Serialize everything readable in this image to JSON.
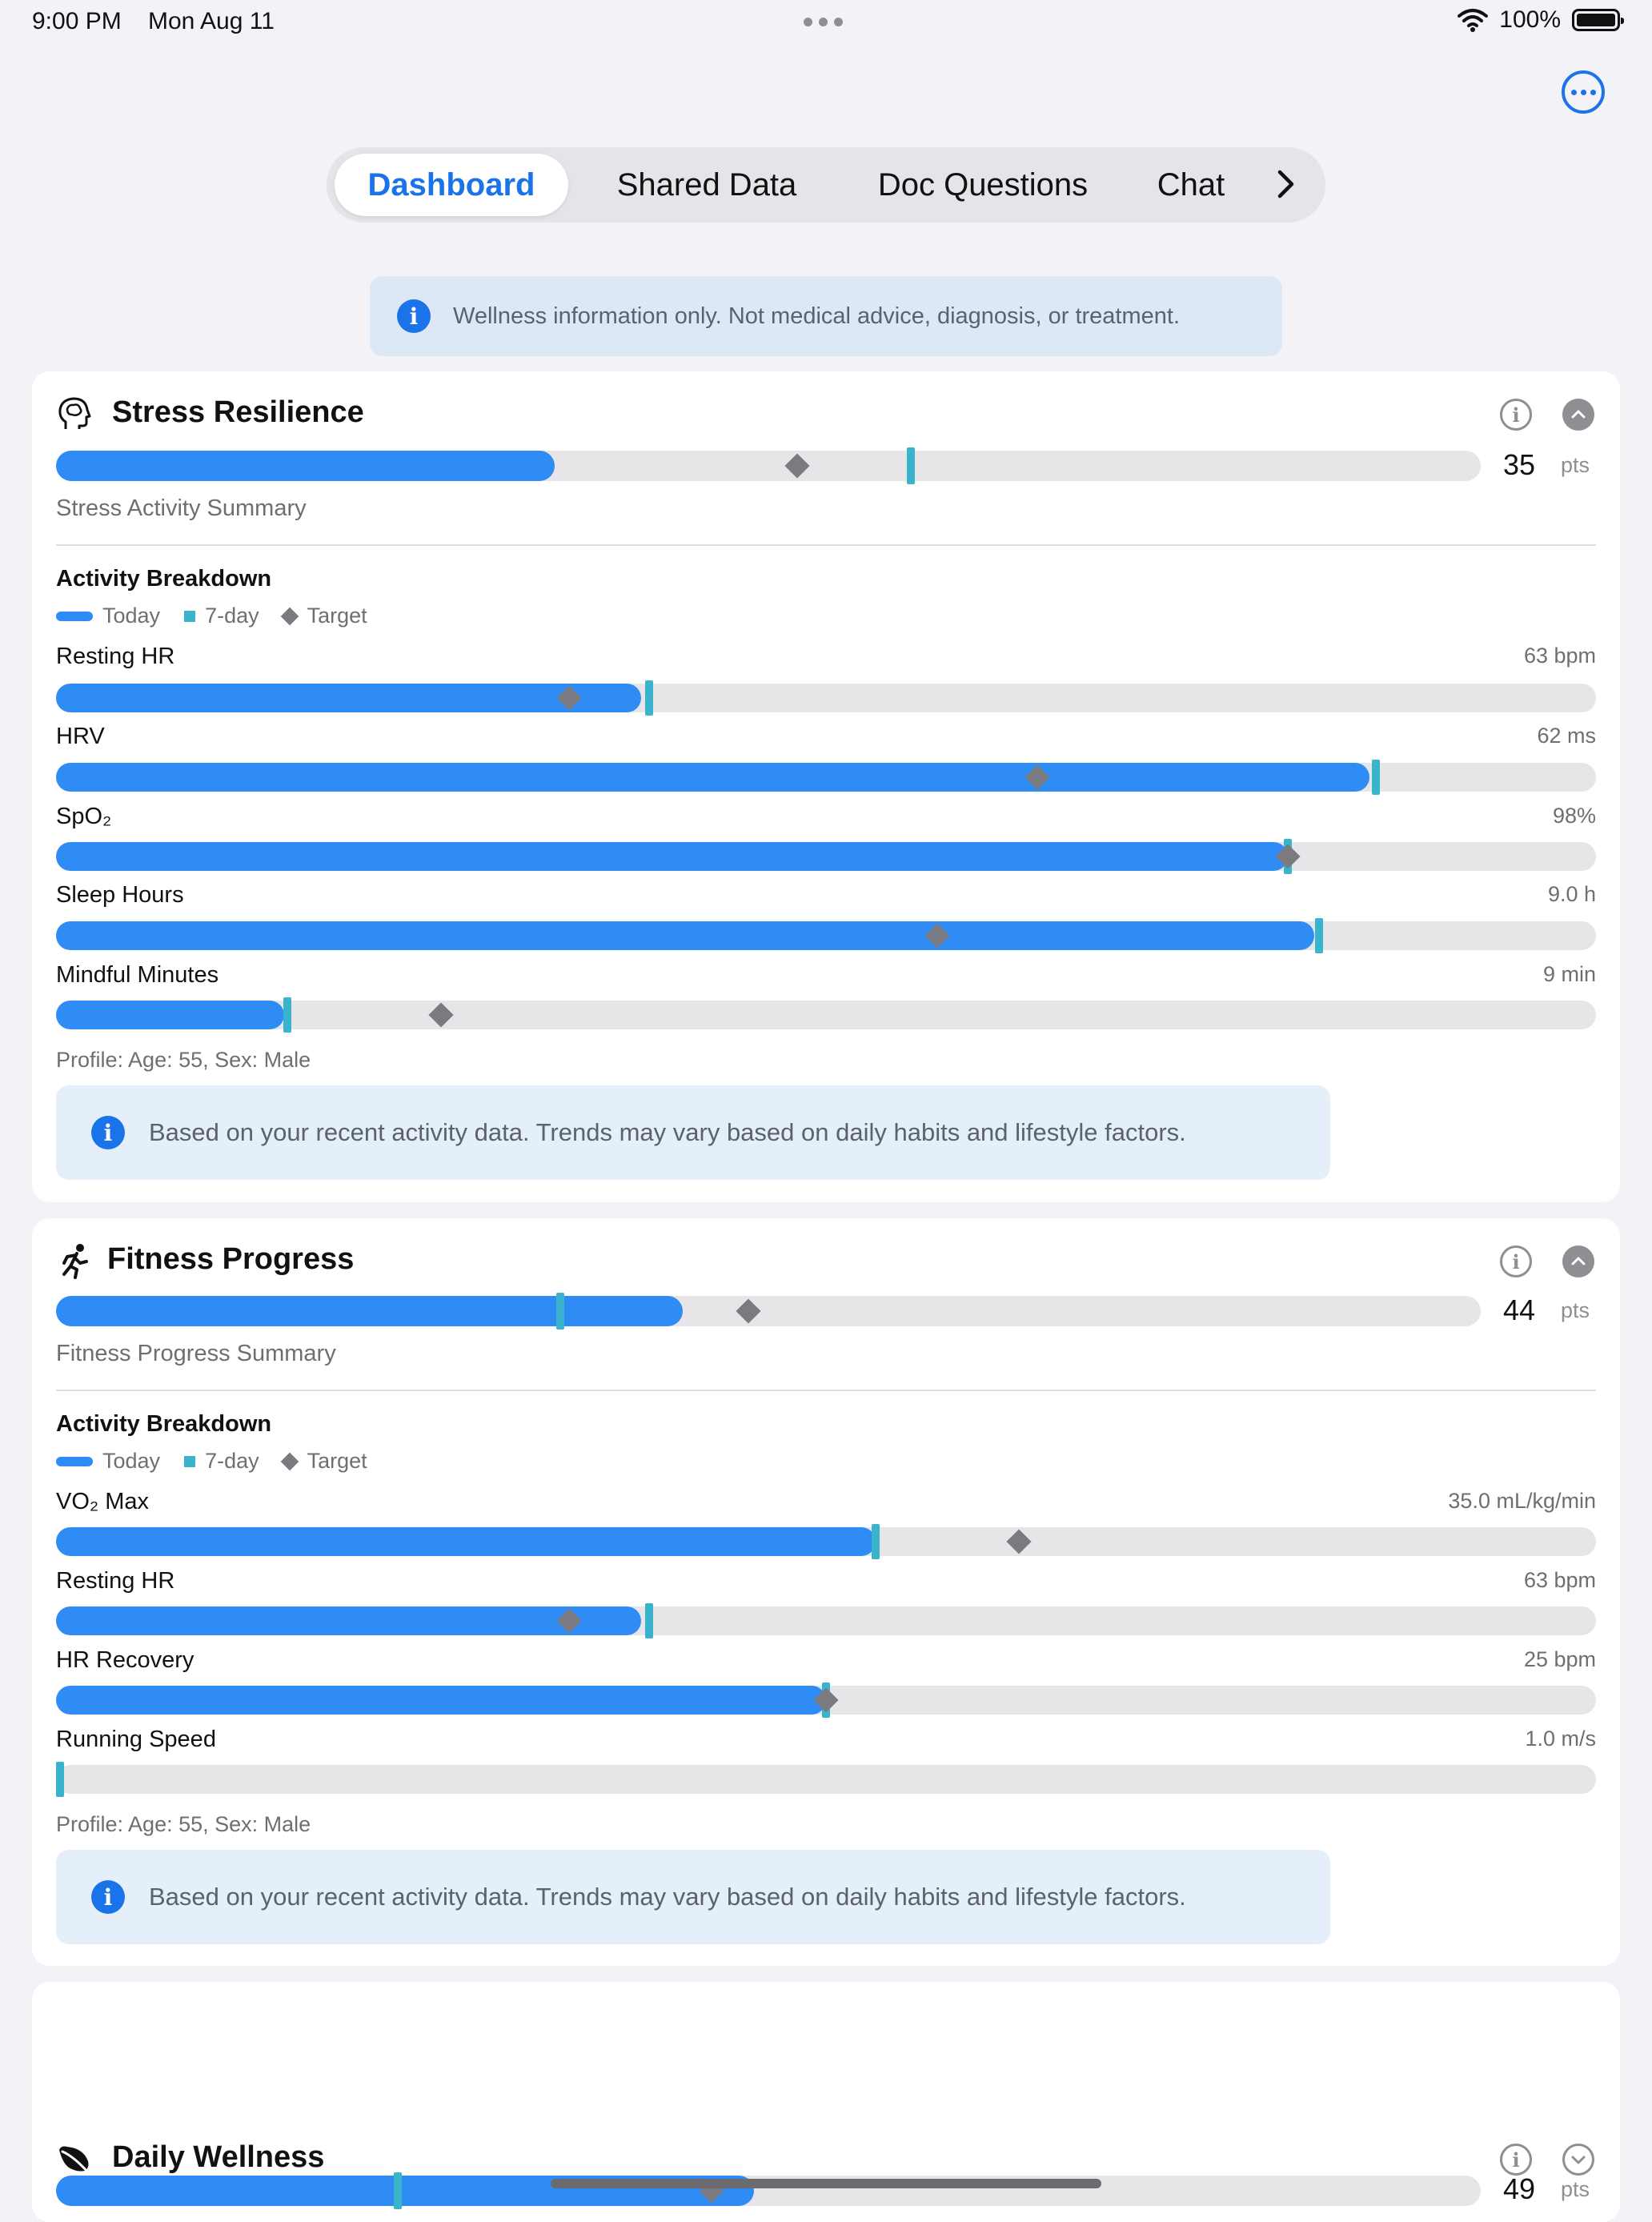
{
  "status": {
    "time": "9:00 PM",
    "date": "Mon Aug 11",
    "battery": "100%"
  },
  "tabs": [
    {
      "label": "Dashboard",
      "active": true
    },
    {
      "label": "Shared Data",
      "active": false
    },
    {
      "label": "Doc Questions",
      "active": false
    },
    {
      "label": "Chat",
      "active": false
    }
  ],
  "banner": {
    "text": "Wellness information only. Not medical advice, diagnosis, or treatment."
  },
  "legend": {
    "today": "Today",
    "seven_day": "7-day",
    "target": "Target"
  },
  "colors": {
    "accent": "#1a73e8",
    "fill": "#2f8cf5",
    "seven_day": "#3ab4cc",
    "target": "#7a7a80",
    "track": "#e6e6e9"
  },
  "cards": [
    {
      "title": "Stress Resilience",
      "icon": "brain-head-icon",
      "score": "35",
      "pts": "pts",
      "main_bar": {
        "today": 0.35,
        "seven_day": 0.6,
        "target": 0.52
      },
      "summary": "Stress Activity Summary",
      "breakdown_title": "Activity Breakdown",
      "metrics": [
        {
          "label": "Resting HR",
          "value": "63 bpm",
          "today": 0.38,
          "seven_day": 0.385,
          "target": 0.333
        },
        {
          "label": "HRV",
          "value": "62 ms",
          "today": 0.853,
          "seven_day": 0.857,
          "target": 0.637
        },
        {
          "label": "SpO₂",
          "value": "98%",
          "today": 0.8,
          "seven_day": 0.8,
          "target": 0.8
        },
        {
          "label": "Sleep Hours",
          "value": "9.0 h",
          "today": 0.817,
          "seven_day": 0.82,
          "target": 0.572
        },
        {
          "label": "Mindful Minutes",
          "value": "9 min",
          "today": 0.148,
          "seven_day": 0.15,
          "target": 0.25
        }
      ],
      "profile": "Profile: Age: 55, Sex: Male",
      "note": "Based on your recent activity data. Trends may vary based on daily habits and lifestyle factors."
    },
    {
      "title": "Fitness Progress",
      "icon": "running-person-icon",
      "score": "44",
      "pts": "pts",
      "main_bar": {
        "today": 0.44,
        "seven_day": 0.354,
        "target": 0.486
      },
      "summary": "Fitness Progress Summary",
      "breakdown_title": "Activity Breakdown",
      "metrics": [
        {
          "label": "VO₂ Max",
          "value": "35.0 mL/kg/min",
          "today": 0.532,
          "seven_day": 0.532,
          "target": 0.625
        },
        {
          "label": "Resting HR",
          "value": "63 bpm",
          "today": 0.38,
          "seven_day": 0.385,
          "target": 0.333
        },
        {
          "label": "HR Recovery",
          "value": "25 bpm",
          "today": 0.5,
          "seven_day": 0.5,
          "target": 0.5
        },
        {
          "label": "Running Speed",
          "value": "1.0 m/s",
          "today": 0.0,
          "seven_day": 0.0,
          "target": null
        }
      ],
      "profile": "Profile: Age: 55, Sex: Male",
      "note": "Based on your recent activity data. Trends may vary based on daily habits and lifestyle factors."
    },
    {
      "title": "Daily Wellness",
      "icon": "leaf-icon",
      "score": "49",
      "pts": "pts",
      "main_bar": {
        "today": 0.49,
        "seven_day": 0.24,
        "target": 0.46
      }
    }
  ]
}
